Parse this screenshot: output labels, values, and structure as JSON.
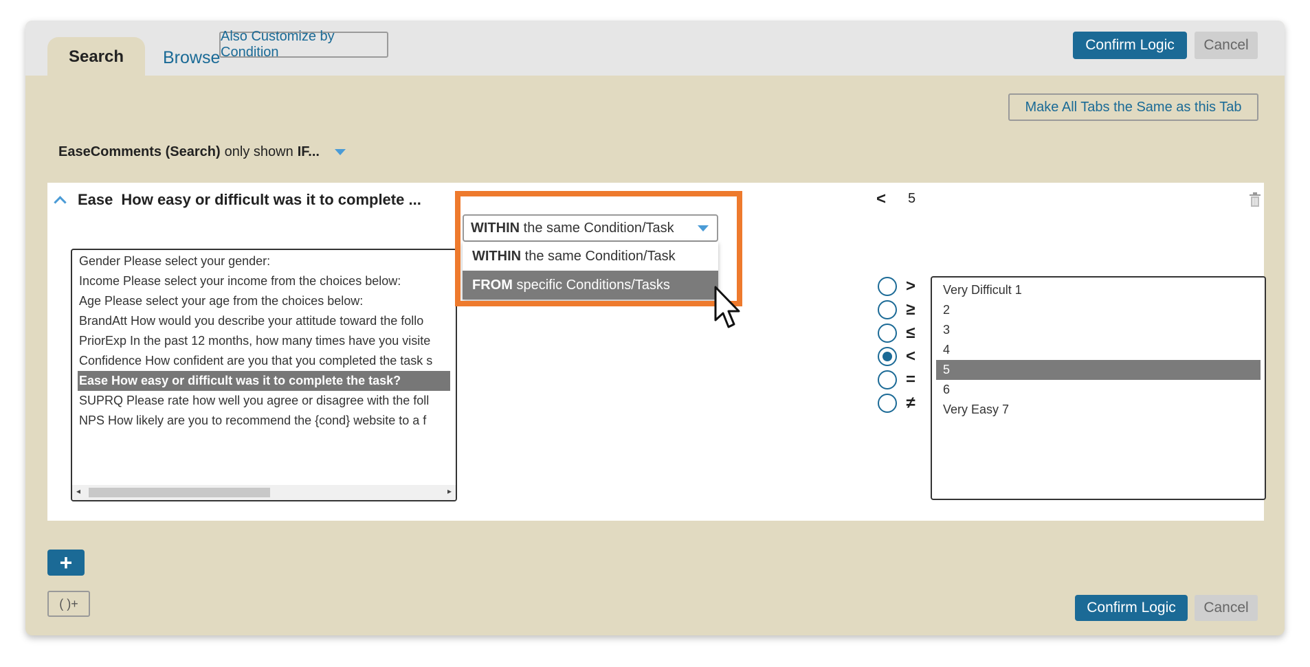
{
  "tabs": [
    {
      "label": "Search",
      "active": true
    },
    {
      "label": "Browse",
      "active": false
    }
  ],
  "toolbar": {
    "customize_label": "Also Customize by Condition",
    "confirm_label": "Confirm Logic",
    "cancel_label": "Cancel",
    "make_all_same_label": "Make All Tabs the Same as this Tab"
  },
  "shown_if": {
    "item": "EaseComments (Search)",
    "text": "only shown",
    "keyword": "IF..."
  },
  "condition": {
    "question_code": "Ease",
    "question_text": "How easy or difficult was it to complete ...",
    "operator": "<",
    "value": "5"
  },
  "scope_select": {
    "selected_bold": "WITHIN",
    "selected_rest": "the same Condition/Task",
    "options": [
      {
        "bold": "WITHIN",
        "rest": "the same Condition/Task",
        "highlighted": false
      },
      {
        "bold": "FROM",
        "rest": "specific Conditions/Tasks",
        "highlighted": true
      }
    ]
  },
  "questions": [
    {
      "text": "Gender Please select your gender:",
      "selected": false
    },
    {
      "text": "Income Please select your income from the choices below:",
      "selected": false
    },
    {
      "text": "Age Please select your age from the choices below:",
      "selected": false
    },
    {
      "text": "BrandAtt How would you describe your attitude toward the follo",
      "selected": false
    },
    {
      "text": "PriorExp In the past 12 months, how many times have you visite",
      "selected": false
    },
    {
      "text": "Confidence How confident are you that you completed the task s",
      "selected": false
    },
    {
      "text": "Ease How easy or difficult was it to complete the task?",
      "selected": true
    },
    {
      "text": "SUPRQ Please rate how well you agree or disagree with the foll",
      "selected": false
    },
    {
      "text": "NPS How likely are you to recommend the {cond} website to a f",
      "selected": false
    }
  ],
  "operators": [
    {
      "symbol": ">",
      "selected": false
    },
    {
      "symbol": "≥",
      "selected": false
    },
    {
      "symbol": "≤",
      "selected": false
    },
    {
      "symbol": "<",
      "selected": true
    },
    {
      "symbol": "=",
      "selected": false
    },
    {
      "symbol": "≠",
      "selected": false
    }
  ],
  "values": [
    {
      "text": "Very Difficult 1",
      "selected": false
    },
    {
      "text": "2",
      "selected": false
    },
    {
      "text": "3",
      "selected": false
    },
    {
      "text": "4",
      "selected": false
    },
    {
      "text": "5",
      "selected": true
    },
    {
      "text": "6",
      "selected": false
    },
    {
      "text": "Very Easy 7",
      "selected": false
    }
  ],
  "footer": {
    "add_label": "+",
    "paren_label": "( )+",
    "confirm_label": "Confirm Logic",
    "cancel_label": "Cancel"
  },
  "colors": {
    "panel_bg": "#e1dac1",
    "primary": "#1b6a96",
    "highlight_frame": "#ee7a2d",
    "link": "#1a6a96"
  },
  "icons": [
    "chevron-up-icon",
    "dropdown-arrow-icon",
    "trash-icon",
    "mouse-cursor-icon",
    "plus-icon"
  ]
}
